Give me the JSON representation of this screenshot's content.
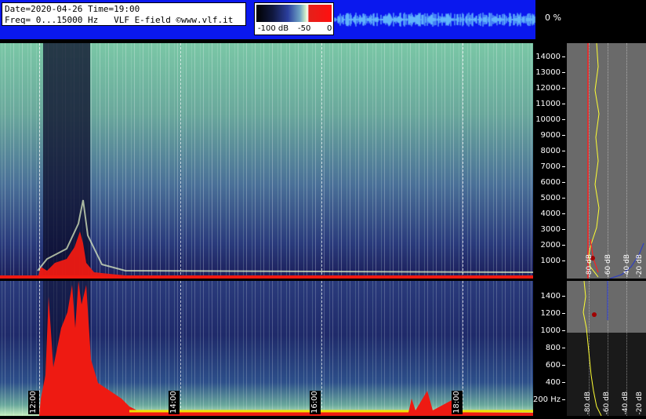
{
  "header": {
    "info_line1": "Date=2020-04-26 Time=19:00",
    "info_line2": "Freq= 0...15000 Hz   VLF E-field ©www.vlf.it",
    "scale_labels": [
      "-100 dB",
      "-50",
      "0"
    ],
    "percent": "0 %"
  },
  "time_labels": [
    "12:00",
    "14:00",
    "16:00",
    "18:00"
  ],
  "freq_top_ticks": [
    "14000",
    "13000",
    "12000",
    "11000",
    "10000",
    "9000",
    "8000",
    "7000",
    "6000",
    "5000",
    "4000",
    "3000",
    "2000",
    "1000"
  ],
  "freq_bottom_ticks": [
    "1400",
    "1200",
    "1000",
    "800",
    "600",
    "400",
    "200 Hz"
  ],
  "spectrum_top_db": [
    "-80 dB",
    "-60 dB",
    "-40 dB",
    "-20 dB"
  ],
  "spectrum_bottom_db": [
    "-80 dB",
    "-60 dB",
    "-40 dB",
    "-20 dB"
  ],
  "colors": {
    "header_bg": "#0a18ee",
    "floor_red": "#ee1a12",
    "trace_yellow": "#ffff33",
    "trace_red": "#ff2020",
    "trace_blue": "#3040c0"
  }
}
